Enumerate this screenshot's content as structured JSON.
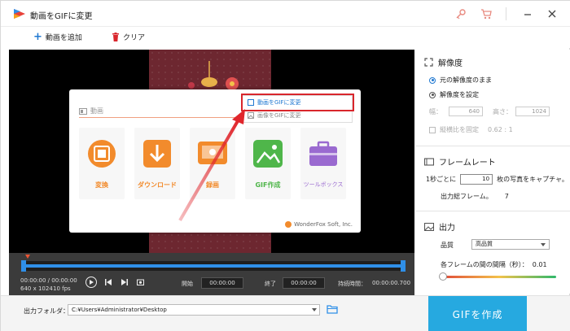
{
  "window": {
    "title": "動画をGIFに変更"
  },
  "toolbar": {
    "add_file": "動画を追加",
    "clear": "クリア"
  },
  "inner_app": {
    "section_label": "動画",
    "cards": [
      {
        "label": "変換",
        "color": "#f28b2c"
      },
      {
        "label": "ダウンロード",
        "color": "#f28b2c"
      },
      {
        "label": "録画",
        "color": "#f28b2c"
      },
      {
        "label": "GIF作成",
        "color": "#4fb64a"
      },
      {
        "label": "ツールボックス",
        "color": "#9a6ad0"
      }
    ],
    "menu": {
      "item1": "動画をGIFに変更",
      "item2": "画像をGIFに変更"
    },
    "brand": "WonderFox Soft, Inc."
  },
  "timeline": {
    "time": "00:00:00 / 00:00:00",
    "resolution": "640 x 1024",
    "fps": "10 fps",
    "start_label": "開始",
    "start_value": "00:00:00",
    "end_label": "終了",
    "end_value": "00:00:00",
    "duration_label": "持続時間：",
    "duration_value": "00:00:00.700"
  },
  "bottom": {
    "output_label": "出力フォルダ：",
    "output_path": "C:¥Users¥Administrator¥Desktop",
    "make_button": "GIFを作成"
  },
  "panel": {
    "resolution": {
      "heading": "解像度",
      "keep_original": "元の解像度のまま",
      "set_resolution": "解像度を設定",
      "width_label": "幅：",
      "width_value": "640",
      "height_label": "高さ：",
      "height_value": "1024",
      "aspect_label": "縦横比を固定",
      "aspect_value": "0.62 : 1"
    },
    "framerate": {
      "heading": "フレームレート",
      "per_second_prefix": "1秒ごとに",
      "per_second_value": "10",
      "per_second_suffix": "枚の写真をキャプチャ。",
      "total_label": "出力総フレーム。",
      "total_value": "7"
    },
    "output": {
      "heading": "出力",
      "quality_label": "品質",
      "quality_value": "高品質",
      "interval_label": "各フレームの間の間隔（秒）：",
      "interval_value": "0.01"
    }
  },
  "colors": {
    "accent": "#26a9e0",
    "highlight": "#d9262c",
    "arrow": "#e0262c"
  }
}
